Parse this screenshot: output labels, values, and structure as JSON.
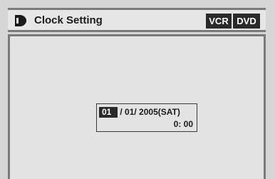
{
  "header": {
    "title": "Clock Setting",
    "icon": "clock-setting-icon",
    "badges": {
      "vcr": "VCR",
      "dvd": "DVD"
    }
  },
  "clock": {
    "month": "01",
    "date_rest": "/ 01/ 2005(SAT)",
    "time": "0: 00"
  },
  "colors": {
    "highlight": "#2a2a2a",
    "panel": "#e3e3e3",
    "frame": "#7a7a7a"
  }
}
